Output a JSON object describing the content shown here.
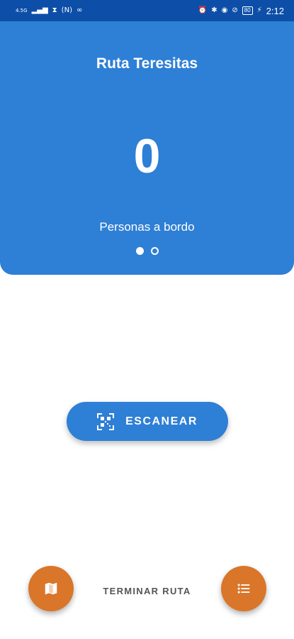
{
  "status_bar": {
    "network": "4.5G",
    "nfc_label": "N",
    "battery": "80",
    "time": "2:12"
  },
  "header": {
    "route_title": "Ruta Teresitas",
    "passenger_count": "0",
    "count_label": "Personas a bordo",
    "pager": {
      "total": 2,
      "active": 0
    }
  },
  "actions": {
    "scan_label": "ESCANEAR",
    "end_route_label": "TERMINAR RUTA"
  },
  "icons": {
    "scan": "qr-code-scanner-icon",
    "map": "map-icon",
    "list": "list-icon"
  },
  "colors": {
    "status_bar": "#0d4fa8",
    "primary": "#2e7fd6",
    "accent": "#d9762a"
  }
}
